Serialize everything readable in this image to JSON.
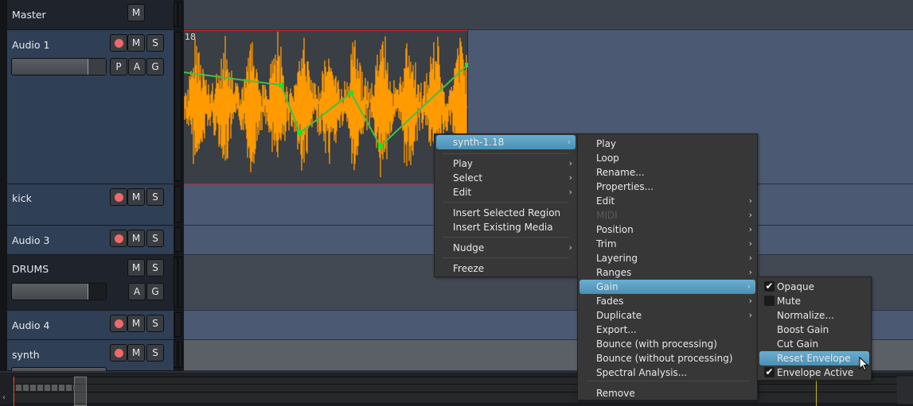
{
  "tracks": [
    {
      "name": "Master",
      "type": "bus",
      "buttons": [
        "M"
      ]
    },
    {
      "name": "Audio 1",
      "type": "audio",
      "buttons": [
        "M",
        "S"
      ],
      "row2": [
        "P",
        "A",
        "G"
      ]
    },
    {
      "name": "kick",
      "type": "audio",
      "buttons": [
        "M",
        "S"
      ]
    },
    {
      "name": "Audio 3",
      "type": "audio",
      "buttons": [
        "M",
        "S"
      ]
    },
    {
      "name": "DRUMS",
      "type": "bus",
      "buttons": [
        "M",
        "S"
      ],
      "row2": [
        "A",
        "G"
      ]
    },
    {
      "name": "Audio 4",
      "type": "audio",
      "buttons": [
        "M",
        "S"
      ]
    },
    {
      "name": "synth",
      "type": "audio",
      "buttons": [
        "M",
        "S"
      ]
    }
  ],
  "region": {
    "label": "18",
    "waveform_color": "#ff9a00",
    "envelope_color": "#44c044"
  },
  "menu_main": {
    "header": "synth-1.18",
    "items": [
      "Play",
      "Select",
      "Edit",
      "Insert Selected Region",
      "Insert Existing Media",
      "Nudge",
      "Freeze"
    ]
  },
  "menu_region": {
    "items": [
      "Play",
      "Loop",
      "Rename...",
      "Properties...",
      "Edit",
      "MIDI",
      "Position",
      "Trim",
      "Layering",
      "Ranges",
      "Gain",
      "Fades",
      "Duplicate",
      "Export...",
      "Bounce (with processing)",
      "Bounce (without processing)",
      "Spectral Analysis...",
      "Remove"
    ]
  },
  "menu_gain": {
    "items": [
      {
        "label": "Opaque",
        "checked": true
      },
      {
        "label": "Mute",
        "checked": false
      },
      {
        "label": "Normalize..."
      },
      {
        "label": "Boost Gain"
      },
      {
        "label": "Cut Gain"
      },
      {
        "label": "Reset Envelope",
        "highlighted": true
      },
      {
        "label": "Envelope Active",
        "checked": true
      }
    ]
  },
  "colors": {
    "highlight": "#5a9ec2",
    "record": "#ee6a6a",
    "track_bg": "#2f3f55"
  }
}
